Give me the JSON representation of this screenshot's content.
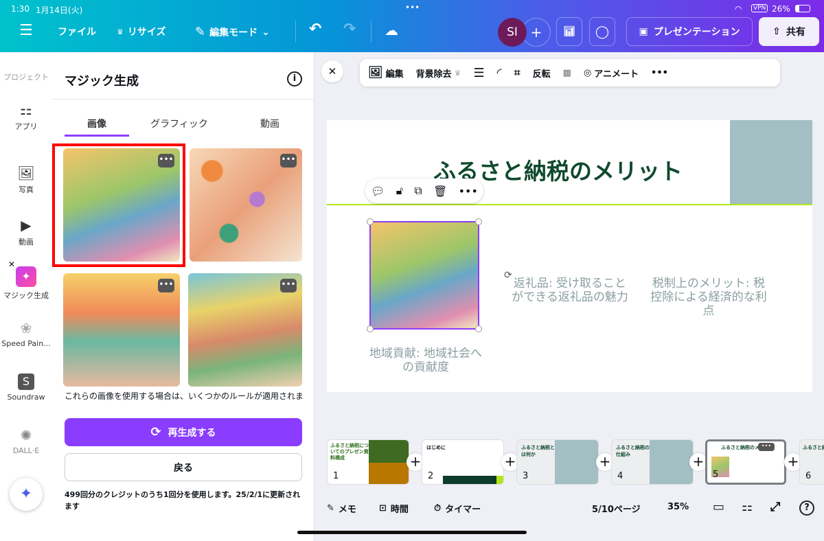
{
  "status": {
    "time": "1:30",
    "date": "1月14日(火)",
    "vpn": "VPN",
    "battery": "26%"
  },
  "topbar": {
    "file": "ファイル",
    "resize": "リサイズ",
    "edit_mode": "編集モード",
    "avatar": "SI",
    "present": "プレゼンテーション",
    "share": "共有"
  },
  "rail": {
    "items": [
      {
        "label": "プロジェクト"
      },
      {
        "label": "アプリ"
      },
      {
        "label": "写真"
      },
      {
        "label": "動画"
      },
      {
        "label": "マジック生成"
      },
      {
        "label": "Speed Pain..."
      },
      {
        "label": "Soundraw"
      },
      {
        "label": "DALL·E"
      }
    ]
  },
  "panel": {
    "title": "マジック生成",
    "tabs": [
      "画像",
      "グラフィック",
      "動画"
    ],
    "notice": "これらの画像を使用する場合は、いくつかのルールが適用されま",
    "regenerate": "再生成する",
    "back": "戻る",
    "credits": "499回分のクレジットのうち1回分を使用します。25/2/1に更新されます"
  },
  "toolbar": {
    "edit": "編集",
    "bg_remove": "背景除去",
    "flip": "反転",
    "animate": "アニメート"
  },
  "slide": {
    "title": "ふるさと納税のメリット",
    "items": [
      "地域貢献: 地域社会への貢献度",
      "返礼品: 受け取ることができる返礼品の魅力",
      "税制上のメリット: 税控除による経済的な利点"
    ]
  },
  "thumbs": [
    {
      "n": "1",
      "title": "ふるさと納税についてのプレゼン資料構成"
    },
    {
      "n": "2",
      "title": "はじめに"
    },
    {
      "n": "3",
      "title": "ふるさと納税とは何か"
    },
    {
      "n": "4",
      "title": "ふるさと納税の仕組み"
    },
    {
      "n": "5",
      "title": "ふるさと納税のメリット"
    },
    {
      "n": "6",
      "title": "ふるさと納税のデメリットと注意点"
    }
  ],
  "bottom": {
    "memo": "メモ",
    "time": "時間",
    "timer": "タイマー",
    "page": "5/10ページ",
    "zoom": "35%"
  },
  "colors": {
    "accent": "#8b3dff",
    "highlight": "#ff0000",
    "title": "#0f4a2e",
    "slate": "#a3bfc4",
    "lime": "#b4e51a"
  }
}
